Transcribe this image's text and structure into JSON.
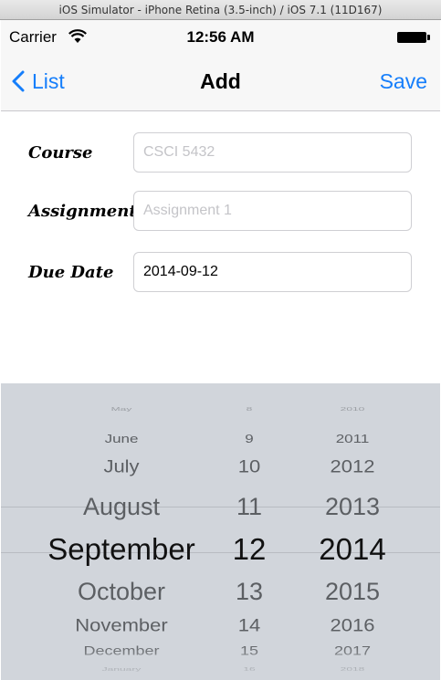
{
  "window": {
    "title": "iOS Simulator - iPhone Retina (3.5-inch) / iOS 7.1 (11D167)"
  },
  "status_bar": {
    "carrier": "Carrier",
    "time": "12:56 AM"
  },
  "nav": {
    "back_label": "List",
    "title": "Add",
    "save_label": "Save"
  },
  "form": {
    "course": {
      "label": "Course",
      "placeholder": "CSCI 5432",
      "value": ""
    },
    "assignment": {
      "label": "Assignment",
      "placeholder": "Assignment 1",
      "value": ""
    },
    "due_date": {
      "label": "Due Date",
      "placeholder": "",
      "value": "2014-09-12"
    }
  },
  "picker": {
    "months": [
      "May",
      "June",
      "July",
      "August",
      "September",
      "October",
      "November",
      "December",
      "January"
    ],
    "days": [
      "8",
      "9",
      "10",
      "11",
      "12",
      "13",
      "14",
      "15",
      "16"
    ],
    "years": [
      "2010",
      "2011",
      "2012",
      "2013",
      "2014",
      "2015",
      "2016",
      "2017",
      "2018"
    ],
    "selected": {
      "month": "September",
      "day": "12",
      "year": "2014"
    }
  },
  "colors": {
    "accent": "#157efb",
    "picker_bg": "#d1d5db"
  }
}
